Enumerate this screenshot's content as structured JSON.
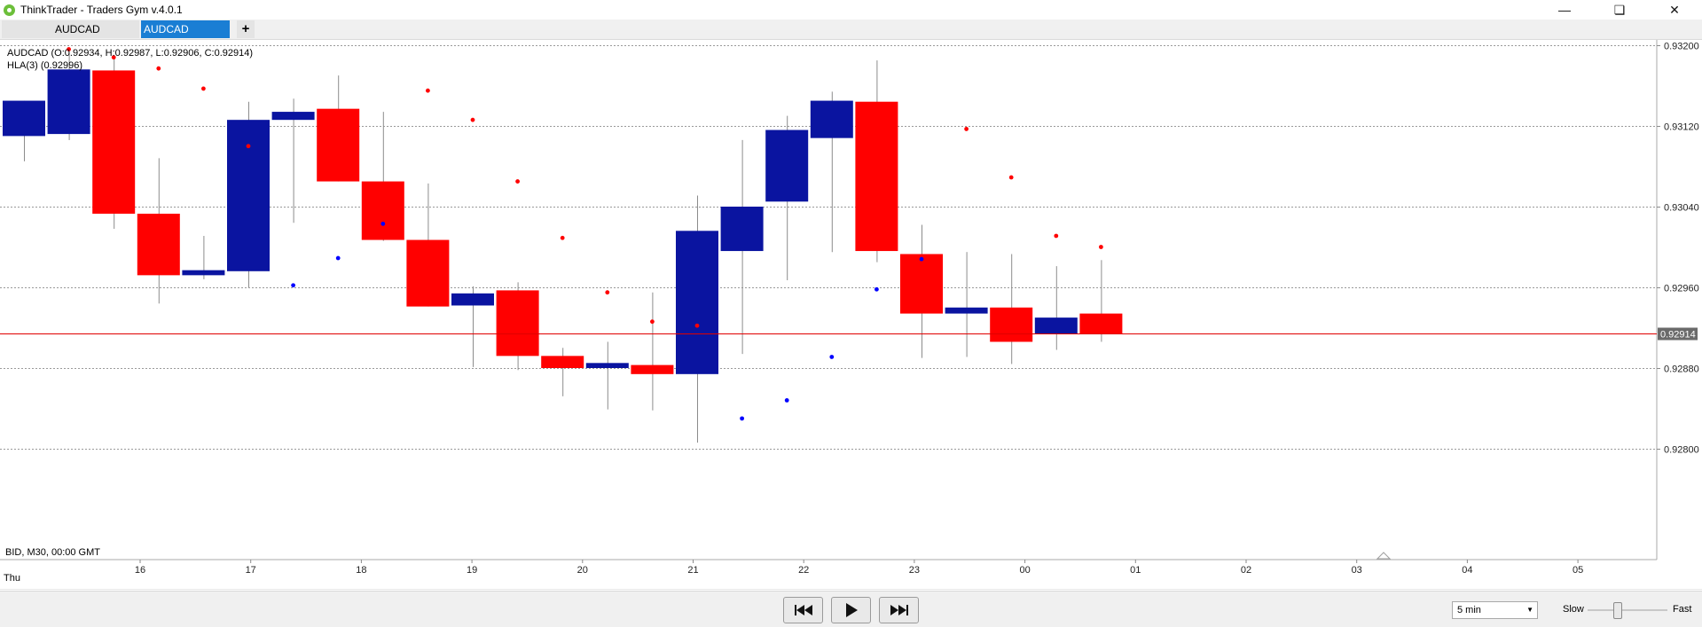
{
  "window": {
    "title": "ThinkTrader - Traders Gym v.4.0.1"
  },
  "tabs": [
    {
      "label": "AUDCAD"
    },
    {
      "label": "AUDCAD"
    }
  ],
  "tab_add_label": "+",
  "chart_info": {
    "ohlc_label": "AUDCAD (O:0.92934, H:0.92987, L:0.92906, C:0.92914)",
    "indicator_label": "HLA(3) (0.92996)",
    "footer_label": "BID, M30, 00:00 GMT",
    "day_label": "Thu",
    "current_price_label": "0.92914"
  },
  "chart_data": {
    "type": "candlestick",
    "symbol": "AUDCAD",
    "timeframe": "M30",
    "x_tick_labels": [
      "16",
      "17",
      "18",
      "19",
      "20",
      "21",
      "22",
      "23",
      "00",
      "01",
      "02",
      "03",
      "04",
      "05"
    ],
    "y_tick_labels": [
      "0.93200",
      "0.93120",
      "0.93040",
      "0.92960",
      "0.92880",
      "0.92800"
    ],
    "ylim": [
      0.92795,
      0.93205
    ],
    "current_price": 0.92914,
    "candles": [
      {
        "o": 0.9311,
        "h": 0.93133,
        "l": 0.93085,
        "c": 0.93145
      },
      {
        "o": 0.93112,
        "h": 0.93192,
        "l": 0.93106,
        "c": 0.93176
      },
      {
        "o": 0.93175,
        "h": 0.93188,
        "l": 0.93018,
        "c": 0.93033
      },
      {
        "o": 0.93033,
        "h": 0.93088,
        "l": 0.92944,
        "c": 0.92972
      },
      {
        "o": 0.92972,
        "h": 0.93011,
        "l": 0.92968,
        "c": 0.92977
      },
      {
        "o": 0.92976,
        "h": 0.93144,
        "l": 0.9296,
        "c": 0.93126
      },
      {
        "o": 0.93126,
        "h": 0.93147,
        "l": 0.93024,
        "c": 0.93134
      },
      {
        "o": 0.93137,
        "h": 0.9317,
        "l": 0.93071,
        "c": 0.93065
      },
      {
        "o": 0.93065,
        "h": 0.93134,
        "l": 0.93006,
        "c": 0.93007
      },
      {
        "o": 0.93007,
        "h": 0.93063,
        "l": 0.92941,
        "c": 0.92941
      },
      {
        "o": 0.92942,
        "h": 0.92961,
        "l": 0.92881,
        "c": 0.92954
      },
      {
        "o": 0.92957,
        "h": 0.92965,
        "l": 0.92878,
        "c": 0.92892
      },
      {
        "o": 0.92892,
        "h": 0.929,
        "l": 0.92852,
        "c": 0.9288
      },
      {
        "o": 0.9288,
        "h": 0.92906,
        "l": 0.92839,
        "c": 0.92885
      },
      {
        "o": 0.92883,
        "h": 0.92955,
        "l": 0.92838,
        "c": 0.92874
      },
      {
        "o": 0.92874,
        "h": 0.93051,
        "l": 0.92806,
        "c": 0.93016
      },
      {
        "o": 0.92996,
        "h": 0.93106,
        "l": 0.92894,
        "c": 0.9304
      },
      {
        "o": 0.93045,
        "h": 0.9313,
        "l": 0.92967,
        "c": 0.93116
      },
      {
        "o": 0.93108,
        "h": 0.93154,
        "l": 0.92995,
        "c": 0.93145
      },
      {
        "o": 0.93144,
        "h": 0.93185,
        "l": 0.92985,
        "c": 0.92996
      },
      {
        "o": 0.92993,
        "h": 0.93022,
        "l": 0.9289,
        "c": 0.92934
      },
      {
        "o": 0.92934,
        "h": 0.92995,
        "l": 0.92891,
        "c": 0.9294
      },
      {
        "o": 0.9294,
        "h": 0.92993,
        "l": 0.92884,
        "c": 0.92906
      },
      {
        "o": 0.92914,
        "h": 0.92981,
        "l": 0.92898,
        "c": 0.9293
      },
      {
        "o": 0.92934,
        "h": 0.92987,
        "l": 0.92906,
        "c": 0.92914
      }
    ],
    "hla_points": [
      {
        "i": 1,
        "v": 0.93196,
        "side": "high"
      },
      {
        "i": 2,
        "v": 0.93188,
        "side": "high"
      },
      {
        "i": 3,
        "v": 0.93177,
        "side": "high"
      },
      {
        "i": 4,
        "v": 0.93157,
        "side": "high"
      },
      {
        "i": 5,
        "v": 0.931,
        "side": "high"
      },
      {
        "i": 6,
        "v": 0.92962,
        "side": "low"
      },
      {
        "i": 7,
        "v": 0.92989,
        "side": "low"
      },
      {
        "i": 8,
        "v": 0.93023,
        "side": "low"
      },
      {
        "i": 9,
        "v": 0.93155,
        "side": "high"
      },
      {
        "i": 10,
        "v": 0.93126,
        "side": "high"
      },
      {
        "i": 11,
        "v": 0.93065,
        "side": "high"
      },
      {
        "i": 12,
        "v": 0.93009,
        "side": "high"
      },
      {
        "i": 13,
        "v": 0.92955,
        "side": "high"
      },
      {
        "i": 14,
        "v": 0.92926,
        "side": "high"
      },
      {
        "i": 15,
        "v": 0.92922,
        "side": "high"
      },
      {
        "i": 16,
        "v": 0.9283,
        "side": "low"
      },
      {
        "i": 17,
        "v": 0.92848,
        "side": "low"
      },
      {
        "i": 18,
        "v": 0.92891,
        "side": "low"
      },
      {
        "i": 19,
        "v": 0.92958,
        "side": "low"
      },
      {
        "i": 20,
        "v": 0.92988,
        "side": "low"
      },
      {
        "i": 21,
        "v": 0.93117,
        "side": "high"
      },
      {
        "i": 22,
        "v": 0.93069,
        "side": "high"
      },
      {
        "i": 23,
        "v": 0.93011,
        "side": "high"
      },
      {
        "i": 24,
        "v": 0.93,
        "side": "high"
      }
    ],
    "colors": {
      "bull": "#0a14a0",
      "bear": "#ff0000",
      "wick": "#8c8c8c",
      "grid": "#9a9a9a",
      "price_line": "#e00000",
      "price_label_bg": "#6a6a6a",
      "dot_high": "#ff0000",
      "dot_low": "#0000ff"
    },
    "grid": true
  },
  "playback": {
    "speed_value": "5 min",
    "slow_label": "Slow",
    "fast_label": "Fast",
    "speed_level": 0.33
  }
}
